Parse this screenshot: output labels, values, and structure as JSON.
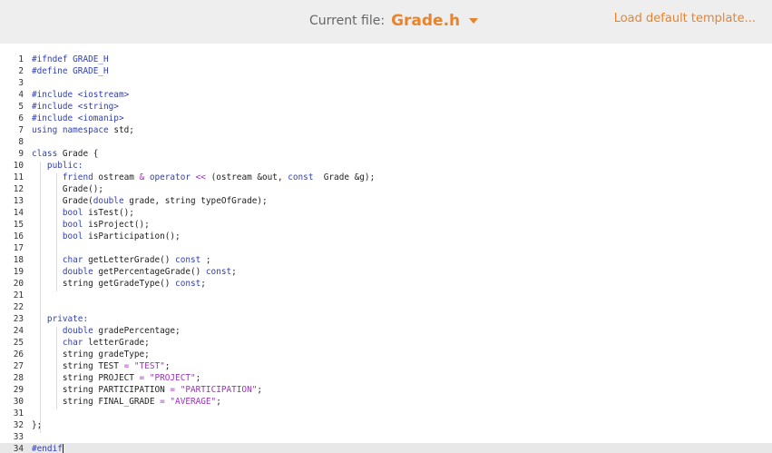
{
  "header": {
    "file_caption": "Current file:",
    "file_name": "Grade.h",
    "load_template": "Load default template..."
  },
  "colors": {
    "accent": "#e8842c",
    "keyword": "#2f3fb5",
    "string": "#9b2fc0",
    "topbar_bg": "#eeeeee"
  },
  "editor": {
    "lines": [
      [
        {
          "t": "#ifndef GRADE_H",
          "c": "dir"
        }
      ],
      [
        {
          "t": "#define GRADE_H",
          "c": "dir"
        }
      ],
      [],
      [
        {
          "t": "#include <iostream>",
          "c": "dir"
        }
      ],
      [
        {
          "t": "#include <string>",
          "c": "dir"
        }
      ],
      [
        {
          "t": "#include <iomanip>",
          "c": "dir"
        }
      ],
      [
        {
          "t": "using namespace ",
          "c": "kw"
        },
        {
          "t": "std;",
          "c": ""
        }
      ],
      [],
      [
        {
          "t": "class ",
          "c": "kw"
        },
        {
          "t": "Grade {",
          "c": ""
        }
      ],
      [
        {
          "t": "   public:",
          "c": "kw"
        }
      ],
      [
        {
          "t": "      friend ",
          "c": "kw"
        },
        {
          "t": "ostream ",
          "c": ""
        },
        {
          "t": "& ",
          "c": "op"
        },
        {
          "t": "operator ",
          "c": "kw"
        },
        {
          "t": "<< ",
          "c": "op"
        },
        {
          "t": "(ostream &out, ",
          "c": ""
        },
        {
          "t": "const ",
          "c": "kw"
        },
        {
          "t": " Grade &g);",
          "c": ""
        }
      ],
      [
        {
          "t": "      Grade();",
          "c": ""
        }
      ],
      [
        {
          "t": "      Grade(",
          "c": ""
        },
        {
          "t": "double ",
          "c": "kw"
        },
        {
          "t": "grade, string typeOfGrade);",
          "c": ""
        }
      ],
      [
        {
          "t": "      bool ",
          "c": "kw"
        },
        {
          "t": "isTest();",
          "c": ""
        }
      ],
      [
        {
          "t": "      bool ",
          "c": "kw"
        },
        {
          "t": "isProject();",
          "c": ""
        }
      ],
      [
        {
          "t": "      bool ",
          "c": "kw"
        },
        {
          "t": "isParticipation();",
          "c": ""
        }
      ],
      [],
      [
        {
          "t": "      char ",
          "c": "kw"
        },
        {
          "t": "getLetterGrade() ",
          "c": ""
        },
        {
          "t": "const ",
          "c": "kw"
        },
        {
          "t": ";",
          "c": ""
        }
      ],
      [
        {
          "t": "      double ",
          "c": "kw"
        },
        {
          "t": "getPercentageGrade() ",
          "c": ""
        },
        {
          "t": "const",
          "c": "kw"
        },
        {
          "t": ";",
          "c": ""
        }
      ],
      [
        {
          "t": "      string getGradeType() ",
          "c": ""
        },
        {
          "t": "const",
          "c": "kw"
        },
        {
          "t": ";",
          "c": ""
        }
      ],
      [],
      [],
      [
        {
          "t": "   private:",
          "c": "kw"
        }
      ],
      [
        {
          "t": "      double ",
          "c": "kw"
        },
        {
          "t": "gradePercentage;",
          "c": ""
        }
      ],
      [
        {
          "t": "      char ",
          "c": "kw"
        },
        {
          "t": "letterGrade;",
          "c": ""
        }
      ],
      [
        {
          "t": "      string gradeType;",
          "c": ""
        }
      ],
      [
        {
          "t": "      string TEST ",
          "c": ""
        },
        {
          "t": "= ",
          "c": "op"
        },
        {
          "t": "\"TEST\"",
          "c": "str"
        },
        {
          "t": ";",
          "c": ""
        }
      ],
      [
        {
          "t": "      string PROJECT ",
          "c": ""
        },
        {
          "t": "= ",
          "c": "op"
        },
        {
          "t": "\"PROJECT\"",
          "c": "str"
        },
        {
          "t": ";",
          "c": ""
        }
      ],
      [
        {
          "t": "      string PARTICIPATION ",
          "c": ""
        },
        {
          "t": "= ",
          "c": "op"
        },
        {
          "t": "\"PARTICIPATION\"",
          "c": "str"
        },
        {
          "t": ";",
          "c": ""
        }
      ],
      [
        {
          "t": "      string FINAL_GRADE ",
          "c": ""
        },
        {
          "t": "= ",
          "c": "op"
        },
        {
          "t": "\"AVERAGE\"",
          "c": "str"
        },
        {
          "t": ";",
          "c": ""
        }
      ],
      [],
      [
        {
          "t": "};",
          "c": ""
        }
      ],
      [],
      [
        {
          "t": "#endif",
          "c": "dir"
        }
      ]
    ],
    "active_line": 34
  }
}
